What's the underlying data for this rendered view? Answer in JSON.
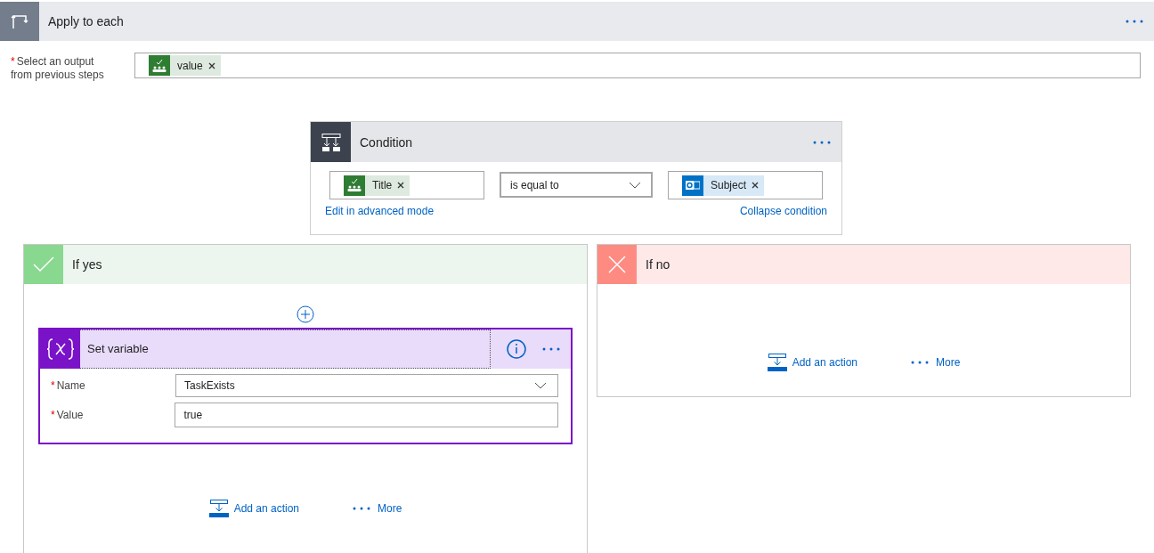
{
  "loop": {
    "title": "Apply to each"
  },
  "output_field": {
    "required_mark": "*",
    "label": "Select an output from previous steps",
    "tokens": [
      {
        "label": "value",
        "kind": "sharepoint"
      }
    ]
  },
  "condition": {
    "title": "Condition",
    "left": {
      "tokens": [
        {
          "label": "Title",
          "kind": "sharepoint"
        }
      ]
    },
    "operator": "is equal to",
    "right": {
      "tokens": [
        {
          "label": "Subject",
          "kind": "outlook"
        }
      ]
    },
    "links": [
      "Edit in advanced mode",
      "Collapse condition"
    ]
  },
  "branches": [
    {
      "kind": "yes",
      "title": "If yes",
      "actions": [
        {
          "title": "Set variable",
          "fields": [
            {
              "label": "Name",
              "required_mark": "*",
              "kind": "dropdown",
              "value": "TaskExists"
            },
            {
              "label": "Value",
              "required_mark": "*",
              "kind": "text",
              "value": "true"
            }
          ]
        }
      ],
      "add_action": "Add an action",
      "more": "More"
    },
    {
      "kind": "no",
      "title": "If no",
      "add_action": "Add an action",
      "more": "More"
    }
  ]
}
